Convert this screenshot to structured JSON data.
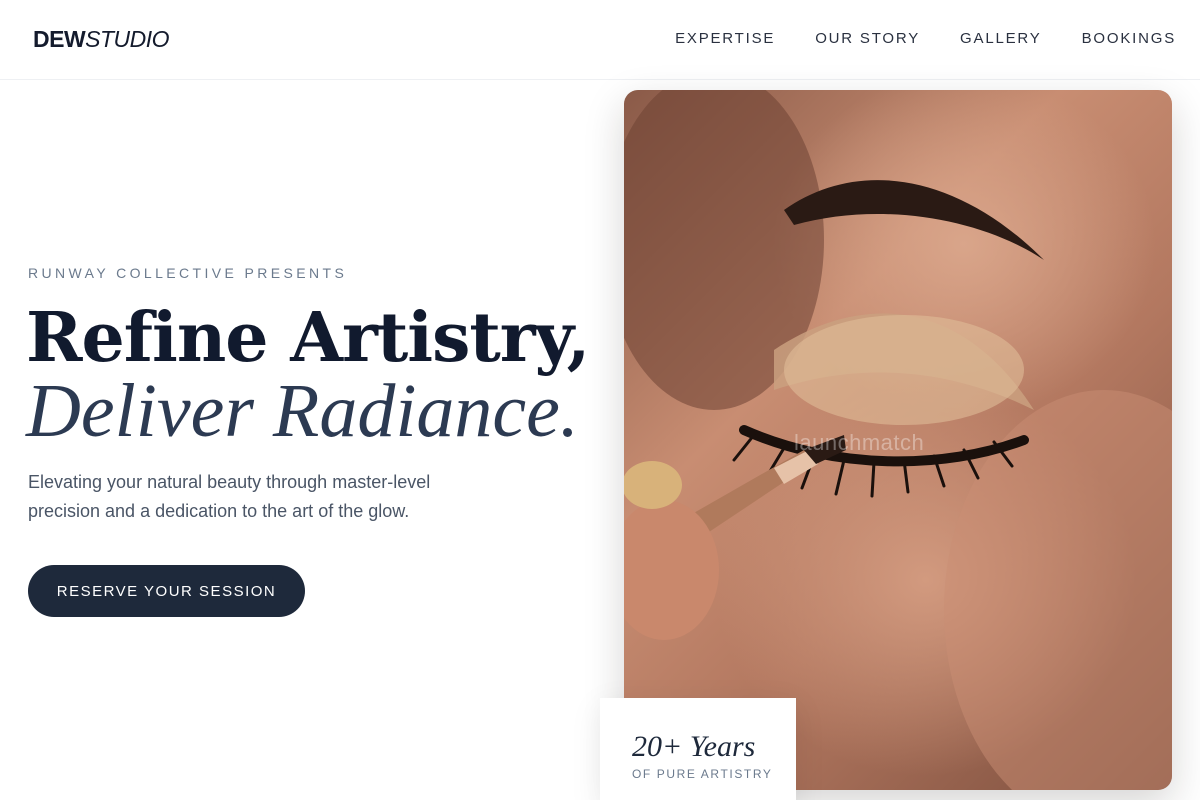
{
  "header": {
    "logo_strong": "DEW",
    "logo_light": "STUDIO",
    "nav": [
      {
        "label": "EXPERTISE"
      },
      {
        "label": "OUR STORY"
      },
      {
        "label": "GALLERY"
      },
      {
        "label": "BOOKINGS"
      }
    ]
  },
  "hero": {
    "eyebrow": "RUNWAY COLLECTIVE PRESENTS",
    "headline_line1": "Refine Artistry,",
    "headline_line2": "Deliver Radiance.",
    "description": "Elevating your natural beauty through master-level precision and a dedication to the art of the glow.",
    "cta_label": "RESERVE YOUR SESSION"
  },
  "image": {
    "watermark": "launchmatch",
    "subject": "eye makeup application"
  },
  "badge": {
    "title": "20+ Years",
    "subtitle": "OF PURE ARTISTRY"
  },
  "colors": {
    "primary": "#1e293b",
    "text_dark": "#111a2e",
    "muted": "#6b7a8d"
  }
}
